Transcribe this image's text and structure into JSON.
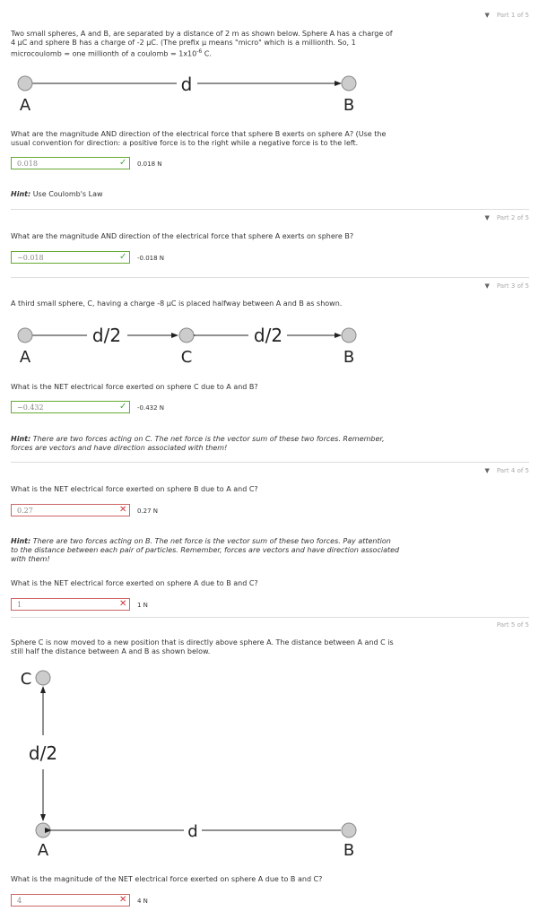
{
  "part1": {
    "label": "Part 1 of 5",
    "intro_a": "Two small spheres, A and B, are separated by a distance of 2 m as shown below. Sphere A has a charge of",
    "intro_b": "4 μC and sphere B has a charge of -2 μC. (The prefix μ means \"micro\" which is a millionth. So, 1",
    "intro_c": "microcoulomb = one millionth of a coulomb = 1x10",
    "intro_exp": "-6",
    "intro_end": " C.",
    "question_a": "What are the magnitude AND direction of the electrical force that sphere B exerts on sphere A? (Use the",
    "question_b": "usual convention for direction: a positive force is to the right while a negative force is to the left.",
    "answer": "0.018",
    "result": "0.018 N",
    "hint_label": "Hint:",
    "hint_text": " Use Coulomb's Law"
  },
  "part2": {
    "label": "Part 2 of 5",
    "question": "What are the magnitude AND direction of the electrical force that sphere A exerts on sphere B?",
    "answer": "−0.018",
    "result": "-0.018 N"
  },
  "part3": {
    "label": "Part 3 of 5",
    "intro": "A third small sphere, C, having a charge -8 μC is placed halfway between A and B as shown.",
    "question": "What is the NET electrical force exerted on sphere C due to A and B?",
    "answer": "−0.432",
    "result": "-0.432 N",
    "hint_label": "Hint:",
    "hint_a": " There are two forces acting on C. The net force is the vector sum of these two forces. Remember,",
    "hint_b": "forces are vectors and have direction associated with them!"
  },
  "part4": {
    "label": "Part 4 of 5",
    "question1": "What is the NET electrical force exerted on sphere B due to A and C?",
    "answer1": "0.27",
    "result1": "0.27 N",
    "hint_label": "Hint:",
    "hint_a": " There are two forces acting on B. The net force is the vector sum of these two forces. Pay attention",
    "hint_b": "to the distance between each pair of particles. Remember, forces are vectors and have direction associated",
    "hint_c": "with them!",
    "question2": "What is the NET electrical force exerted on sphere A due to B and C?",
    "answer2": "1",
    "result2": "1 N"
  },
  "part5": {
    "label": "Part 5 of 5",
    "intro_a": "Sphere C is now moved to a new position that is directly above sphere A. The distance between A and C is",
    "intro_b": "still half the distance between A and B as shown below.",
    "question": "What is the magnitude of the NET electrical force exerted on sphere A due to B and C?",
    "answer": "4",
    "result": "4 N"
  },
  "diagrams": {
    "A": "A",
    "B": "B",
    "C": "C",
    "d": "d",
    "d_half": "d/2"
  },
  "icons": {
    "correct": "check-icon",
    "wrong": "x-icon",
    "collapse": "triangle-down-icon"
  },
  "colors": {
    "correct": "#66aa33",
    "wrong": "#cc6666"
  }
}
